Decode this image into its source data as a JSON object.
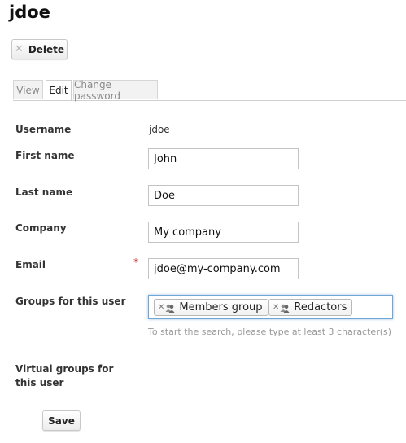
{
  "page": {
    "title": "jdoe"
  },
  "toolbar": {
    "delete_label": "Delete",
    "delete_icon": "close-icon"
  },
  "tabs": [
    {
      "label": "View",
      "active": false
    },
    {
      "label": "Edit",
      "active": true
    },
    {
      "label": "Change password",
      "active": false
    }
  ],
  "form": {
    "username": {
      "label": "Username",
      "value": "jdoe"
    },
    "first_name": {
      "label": "First name",
      "value": "John"
    },
    "last_name": {
      "label": "Last name",
      "value": "Doe"
    },
    "company": {
      "label": "Company",
      "value": "My company"
    },
    "email": {
      "label": "Email",
      "value": "jdoe@my-company.com",
      "required_marker": "*"
    },
    "groups": {
      "label": "Groups for this user",
      "chips": [
        {
          "label": "Members group",
          "icon": "group-icon"
        },
        {
          "label": "Redactors",
          "icon": "group-icon"
        }
      ],
      "hint": "To start the search, please type at least 3 character(s)"
    },
    "virtual_groups": {
      "label": "Virtual groups for this user"
    },
    "save_label": "Save"
  },
  "colors": {
    "required": "#cc2222",
    "focus_border": "#6ea7d6"
  }
}
